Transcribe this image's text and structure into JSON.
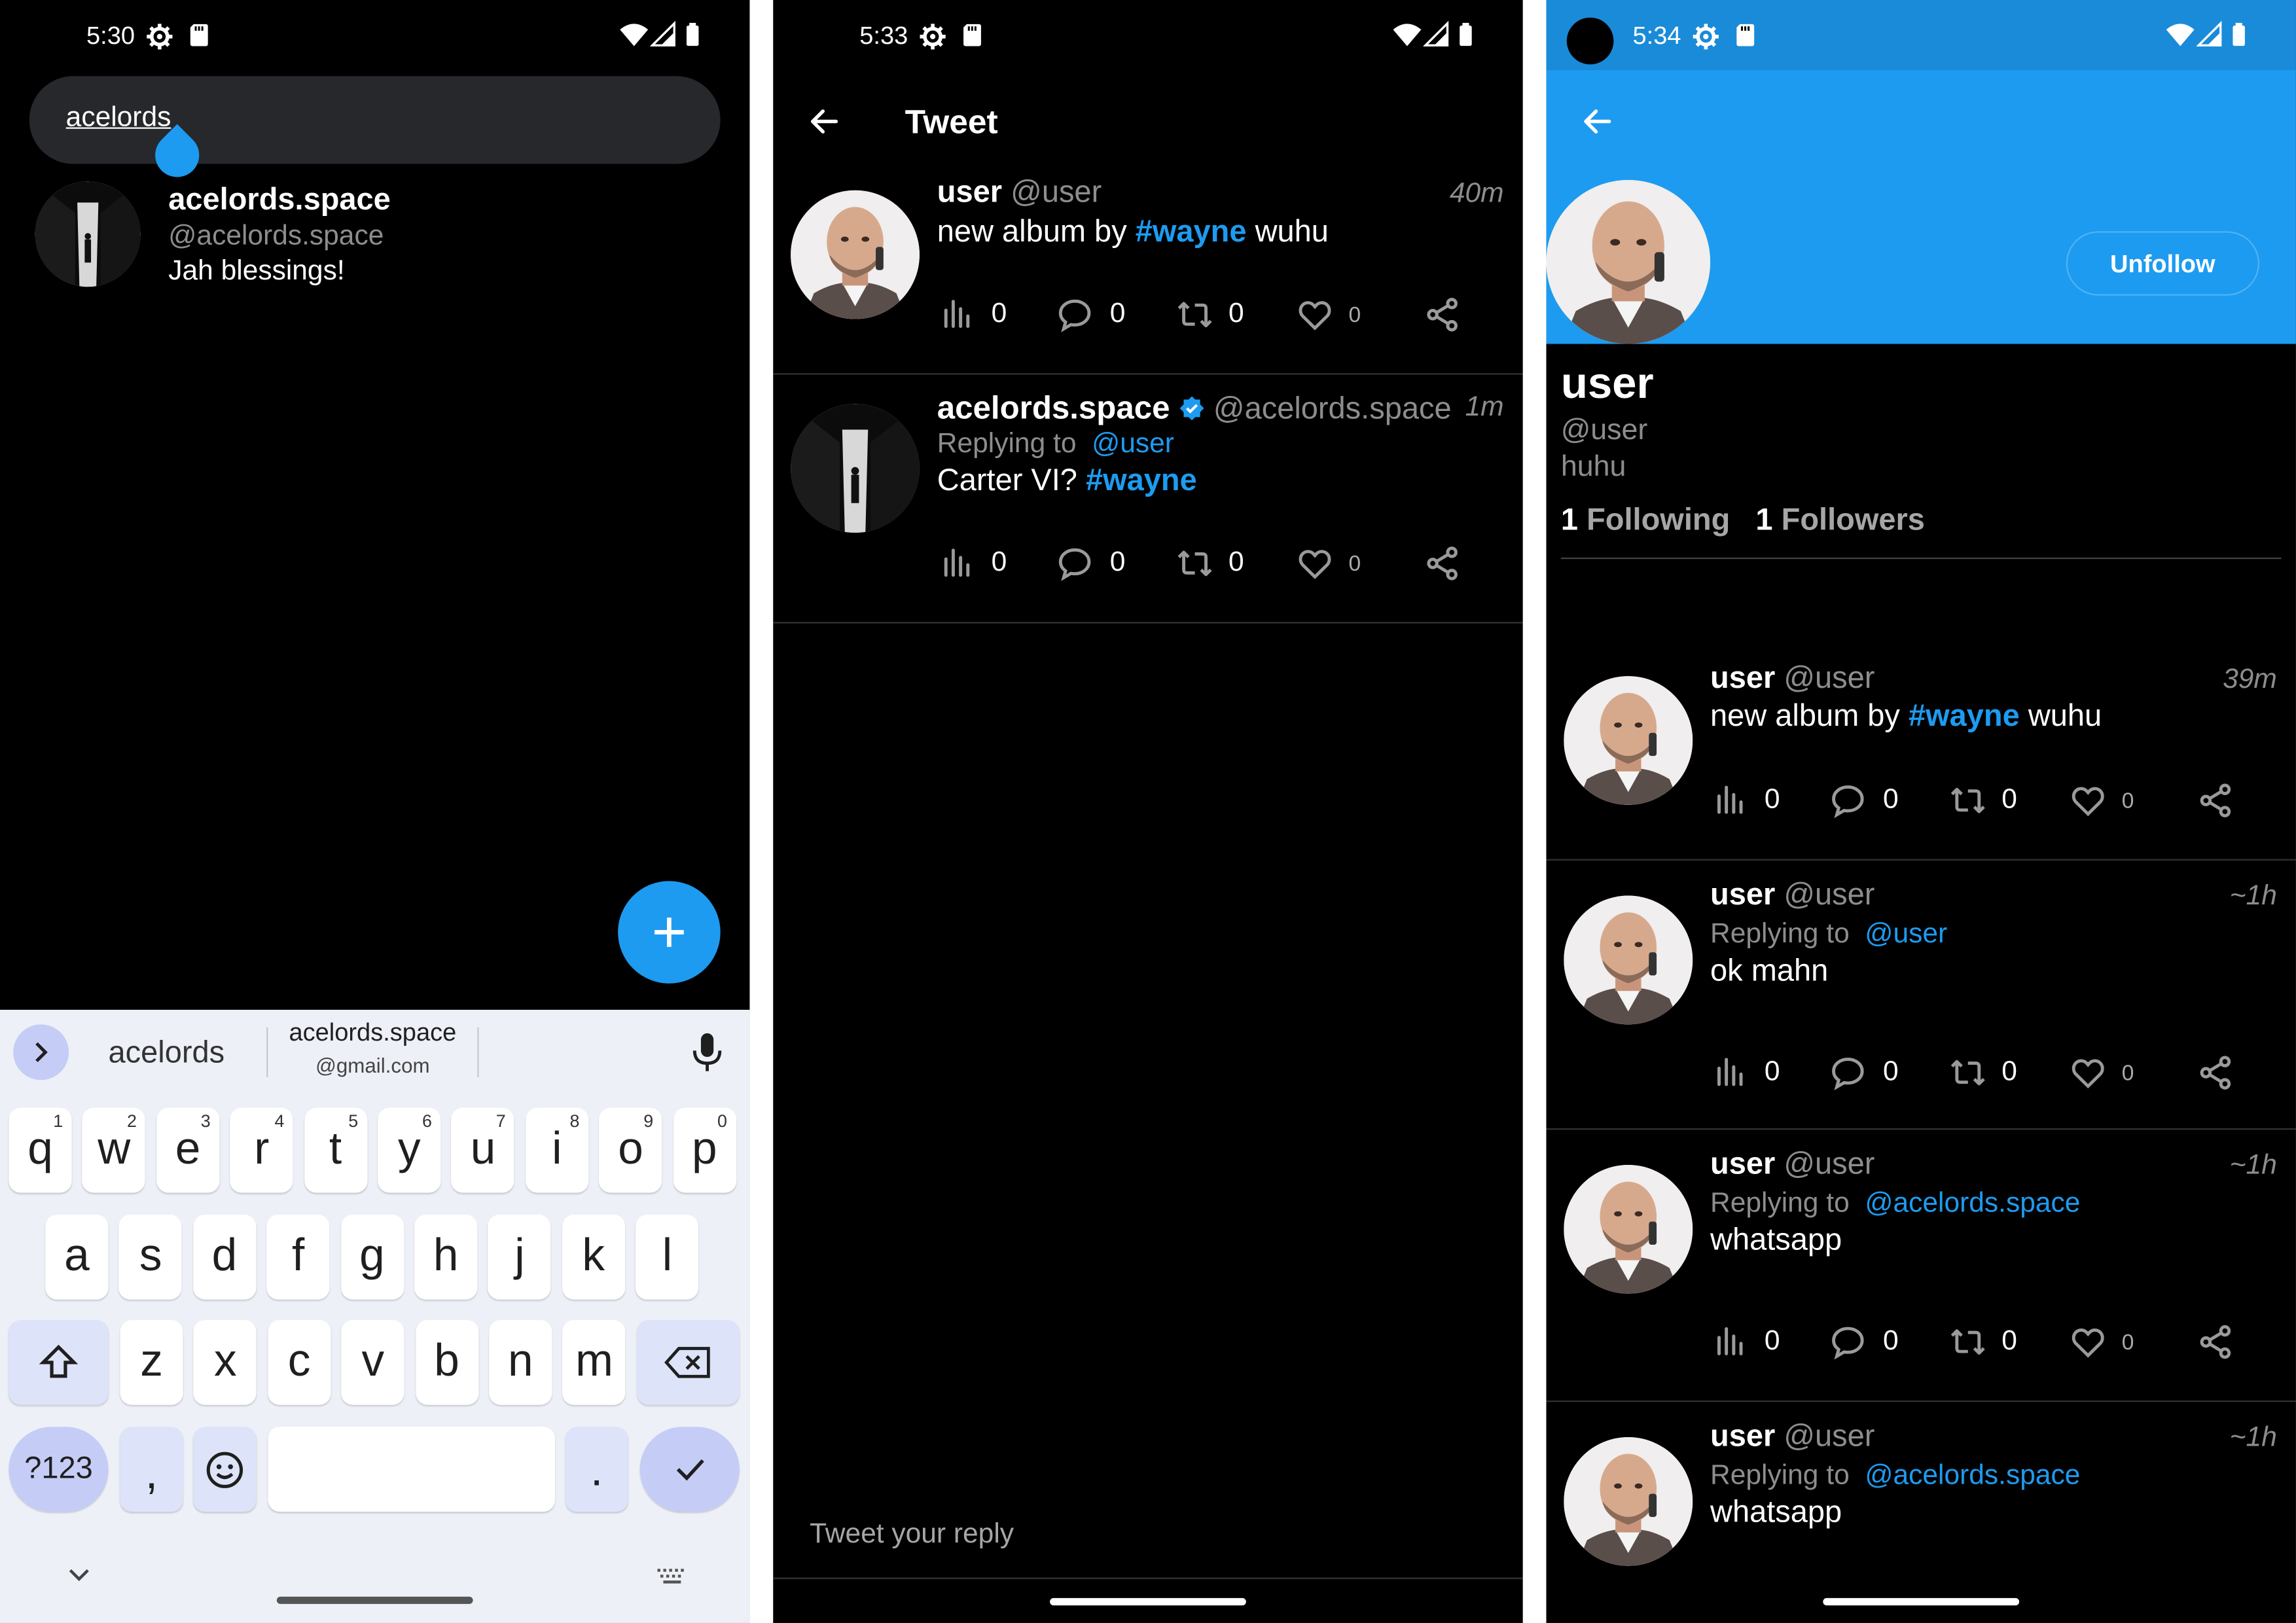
{
  "panel1": {
    "status_time": "5:30",
    "search_value": "acelords",
    "result": {
      "name": "acelords.space",
      "handle": "@acelords.space",
      "bio": "Jah blessings!"
    },
    "fab_icon": "plus-icon",
    "keyboard": {
      "suggestion_1": "acelords",
      "suggestion_2_top": "acelords.space",
      "suggestion_2_bottom": "@gmail.com",
      "row1": [
        [
          "q",
          "1"
        ],
        [
          "w",
          "2"
        ],
        [
          "e",
          "3"
        ],
        [
          "r",
          "4"
        ],
        [
          "t",
          "5"
        ],
        [
          "y",
          "6"
        ],
        [
          "u",
          "7"
        ],
        [
          "i",
          "8"
        ],
        [
          "o",
          "9"
        ],
        [
          "p",
          "0"
        ]
      ],
      "row2": [
        "a",
        "s",
        "d",
        "f",
        "g",
        "h",
        "j",
        "k",
        "l"
      ],
      "row3": [
        "z",
        "x",
        "c",
        "v",
        "b",
        "n",
        "m"
      ],
      "symbols_key": "?123",
      "comma_key": ",",
      "period_key": "."
    }
  },
  "panel2": {
    "status_time": "5:33",
    "title": "Tweet",
    "tweet1": {
      "name": "user",
      "handle": "@user",
      "time": "40m",
      "text_pre": "new album by ",
      "hashtag": "#wayne",
      "text_post": " wuhu",
      "views": "0",
      "replies": "0",
      "retweets": "0",
      "likes": "0"
    },
    "tweet2": {
      "name": "acelords.space",
      "handle": "@acelords.space",
      "time": "1m",
      "replying_label": "Replying to",
      "replying_to": "@user",
      "text_pre": "Carter VI? ",
      "hashtag": "#wayne",
      "views": "0",
      "replies": "0",
      "retweets": "0",
      "likes": "0"
    },
    "reply_placeholder": "Tweet your reply"
  },
  "panel3": {
    "status_time": "5:34",
    "unfollow_label": "Unfollow",
    "profile": {
      "name": "user",
      "handle": "@user",
      "bio": "huhu",
      "following_count": "1",
      "following_label": "Following",
      "followers_count": "1",
      "followers_label": "Followers"
    },
    "tweets": [
      {
        "name": "user",
        "handle": "@user",
        "time": "39m",
        "text_pre": "new album by ",
        "hashtag": "#wayne",
        "text_post": " wuhu",
        "views": "0",
        "replies": "0",
        "retweets": "0",
        "likes": "0"
      },
      {
        "name": "user",
        "handle": "@user",
        "time": "~1h",
        "replying_label": "Replying to",
        "replying_to": "@user",
        "text": "ok mahn",
        "views": "0",
        "replies": "0",
        "retweets": "0",
        "likes": "0"
      },
      {
        "name": "user",
        "handle": "@user",
        "time": "~1h",
        "replying_label": "Replying to",
        "replying_to": "@acelords.space",
        "text": "whatsapp",
        "views": "0",
        "replies": "0",
        "retweets": "0",
        "likes": "0"
      },
      {
        "name": "user",
        "handle": "@user",
        "time": "~1h",
        "replying_label": "Replying to",
        "replying_to": "@acelords.space",
        "text": "whatsapp"
      }
    ]
  },
  "colors": {
    "accent": "#1d9bf0",
    "profile_banner": "#1d9bf0",
    "background": "#000000",
    "keyboard_bg": "#eef0f8",
    "keyboard_accent": "#c5cdf6"
  }
}
